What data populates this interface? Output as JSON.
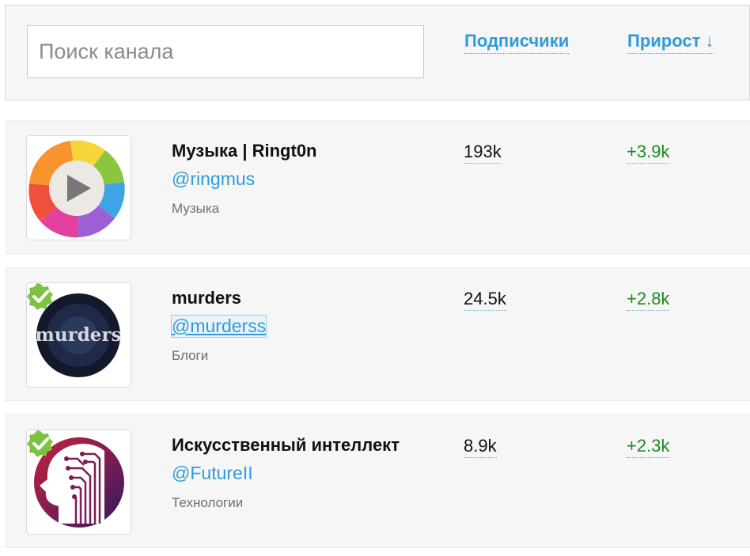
{
  "search": {
    "placeholder": "Поиск канала"
  },
  "columns": {
    "subscribers": "Подписчики",
    "growth": "Прирост",
    "growth_sort_icon": "↓"
  },
  "channels": [
    {
      "title": "Музыка | Ringt0n",
      "handle": "@ringmus",
      "category": "Музыка",
      "subscribers": "193k",
      "growth": "+3.9k",
      "verified": false,
      "avatar_icon": "play-logo-icon"
    },
    {
      "title": "murders",
      "handle": "@murderss",
      "category": "Блоги",
      "subscribers": "24.5k",
      "growth": "+2.8k",
      "verified": true,
      "avatar_icon": "murders-logo-icon",
      "avatar_text": "murders"
    },
    {
      "title": "Искусственный интеллект",
      "handle": "@FutureII",
      "category": "Технологии",
      "subscribers": "8.9k",
      "growth": "+2.3k",
      "verified": true,
      "avatar_icon": "ai-head-logo-icon"
    }
  ],
  "colors": {
    "link": "#2f9bd9",
    "growth": "#1e8a1e",
    "verified": "#7dc242",
    "row_bg": "#f6f6f6"
  }
}
